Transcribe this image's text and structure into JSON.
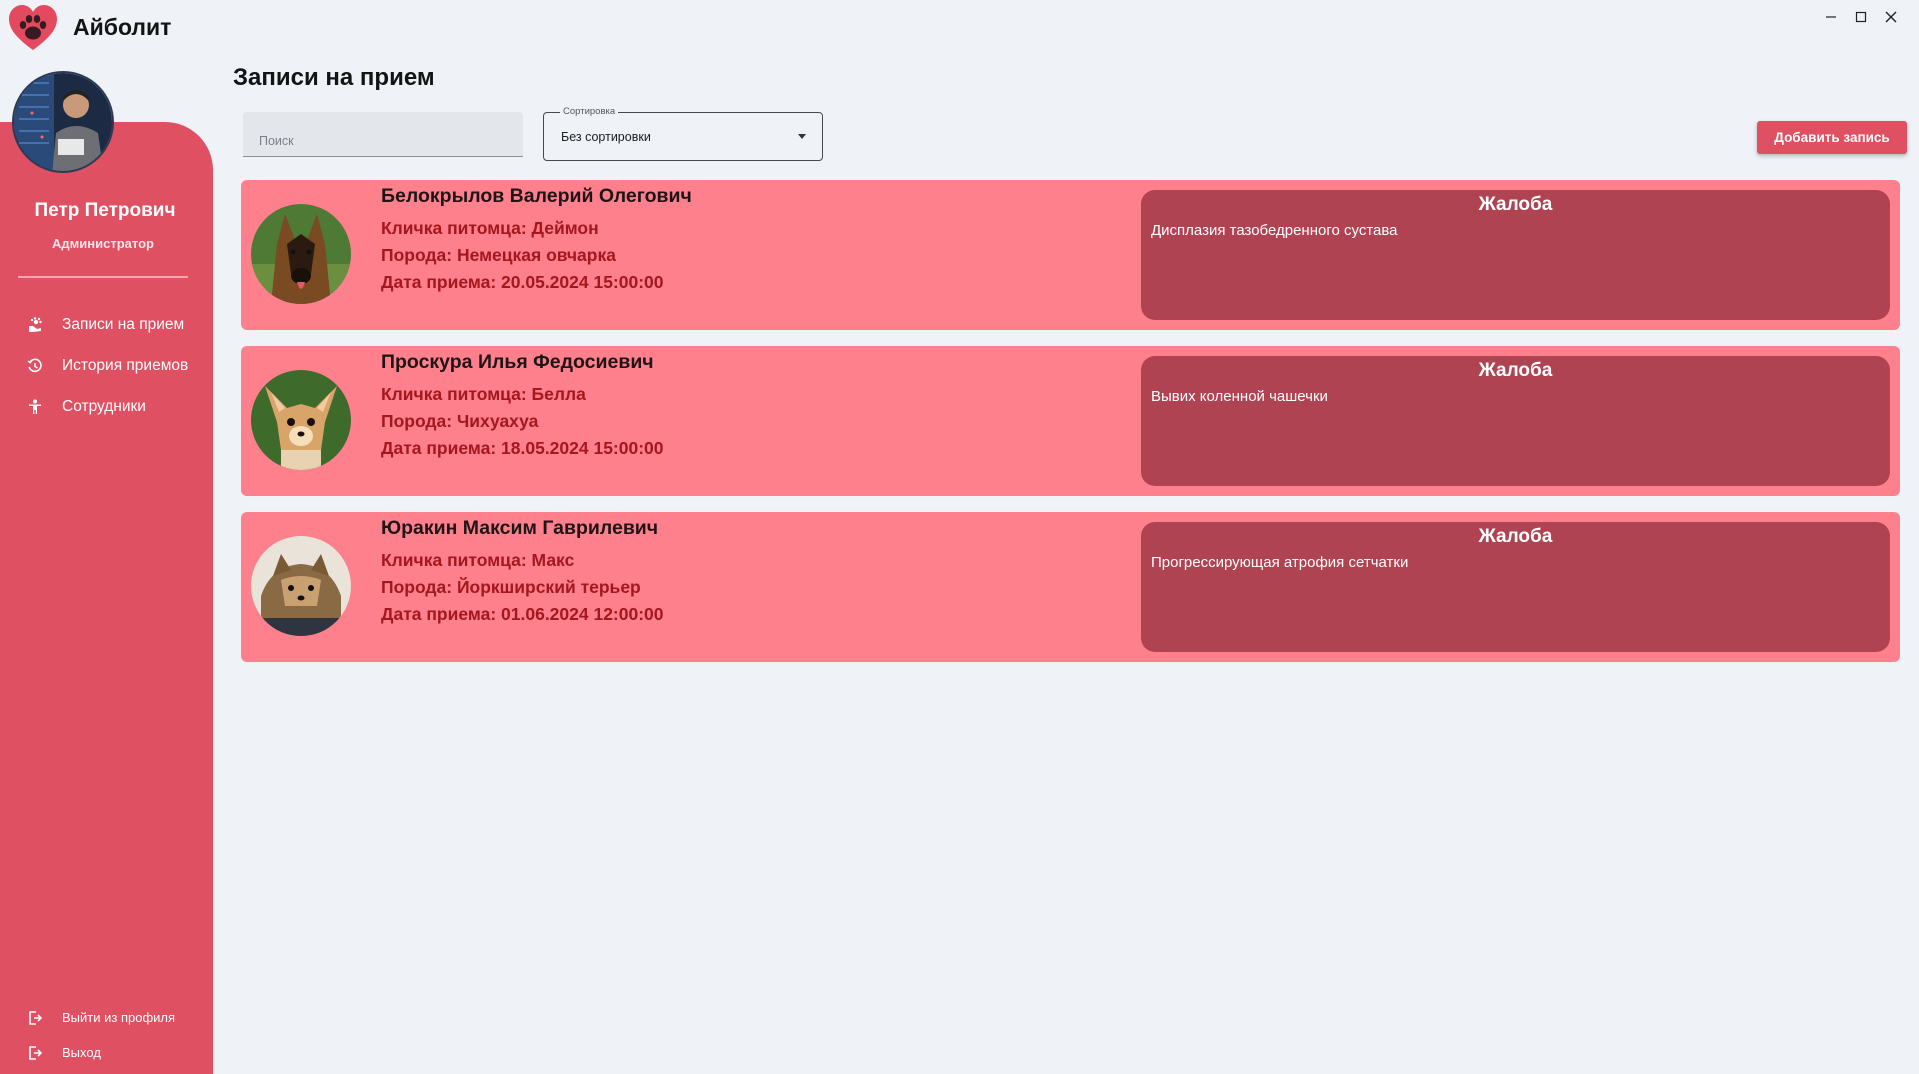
{
  "app": {
    "title": "Айболит"
  },
  "window_controls": {
    "minimize_icon": "minimize-icon",
    "maximize_icon": "maximize-icon",
    "close_icon": "close-icon"
  },
  "colors": {
    "accent": "#df5062",
    "card": "#fe808c",
    "complaint_bg": "#b04352",
    "pet_text": "#a4171f"
  },
  "user": {
    "name": "Петр Петрович",
    "role": "Администратор"
  },
  "sidebar": {
    "items": [
      {
        "label": "Записи на прием",
        "icon": "paw-hand-icon"
      },
      {
        "label": "История приемов",
        "icon": "history-icon"
      },
      {
        "label": "Сотрудники",
        "icon": "person-icon"
      }
    ],
    "bottom": [
      {
        "label": "Выйти из профиля",
        "icon": "logout-icon"
      },
      {
        "label": "Выход",
        "icon": "exit-icon"
      }
    ]
  },
  "main": {
    "title": "Записи на прием",
    "search": {
      "placeholder": "Поиск",
      "value": ""
    },
    "sort": {
      "label": "Сортировка",
      "value": "Без сортировки"
    },
    "add_button": "Добавить запись"
  },
  "appointments": [
    {
      "owner": "Белокрылов Валерий Олегович",
      "pet_name": "Кличка питомца: Деймон",
      "breed": "Порода: Немецкая овчарка",
      "date": "Дата приема: 20.05.2024 15:00:00",
      "complaint_title": "Жалоба",
      "complaint": "Дисплазия тазобедренного сустава"
    },
    {
      "owner": "Проскура Илья Федосиевич",
      "pet_name": "Кличка питомца: Белла",
      "breed": "Порода: Чихуахуа",
      "date": "Дата приема: 18.05.2024 15:00:00",
      "complaint_title": "Жалоба",
      "complaint": "Вывих коленной чашечки"
    },
    {
      "owner": "Юракин Максим Гаврилевич",
      "pet_name": "Кличка питомца: Макс",
      "breed": "Порода: Йоркширский терьер",
      "date": "Дата приема: 01.06.2024 12:00:00",
      "complaint_title": "Жалоба",
      "complaint": "Прогрессирующая атрофия сетчатки"
    }
  ]
}
